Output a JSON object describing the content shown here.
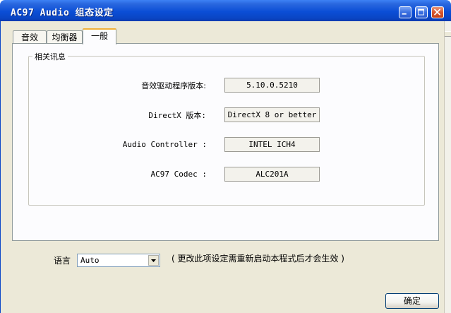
{
  "window": {
    "title": "AC97 Audio 组态设定"
  },
  "tabs": [
    {
      "label": "音效",
      "active": false
    },
    {
      "label": "均衡器",
      "active": false
    },
    {
      "label": "一般",
      "active": true
    }
  ],
  "info_group": {
    "legend": "相关讯息",
    "rows": [
      {
        "label": "音效驱动程序版本:",
        "value": "5.10.0.5210"
      },
      {
        "label": "DirectX 版本:",
        "value": "DirectX 8 or better"
      },
      {
        "label": "Audio Controller :",
        "value": "INTEL ICH4"
      },
      {
        "label": "AC97 Codec :",
        "value": "ALC201A"
      }
    ]
  },
  "language": {
    "label": "语言",
    "selected": "Auto",
    "note": "( 更改此项设定需重新启动本程式后才会生效 )"
  },
  "buttons": {
    "ok": "确定"
  },
  "colors": {
    "titlebar": "#0b4ed6",
    "window_bg": "#ece9d8",
    "tab_active_accent": "#f0b03a",
    "close_button": "#d8572f"
  }
}
